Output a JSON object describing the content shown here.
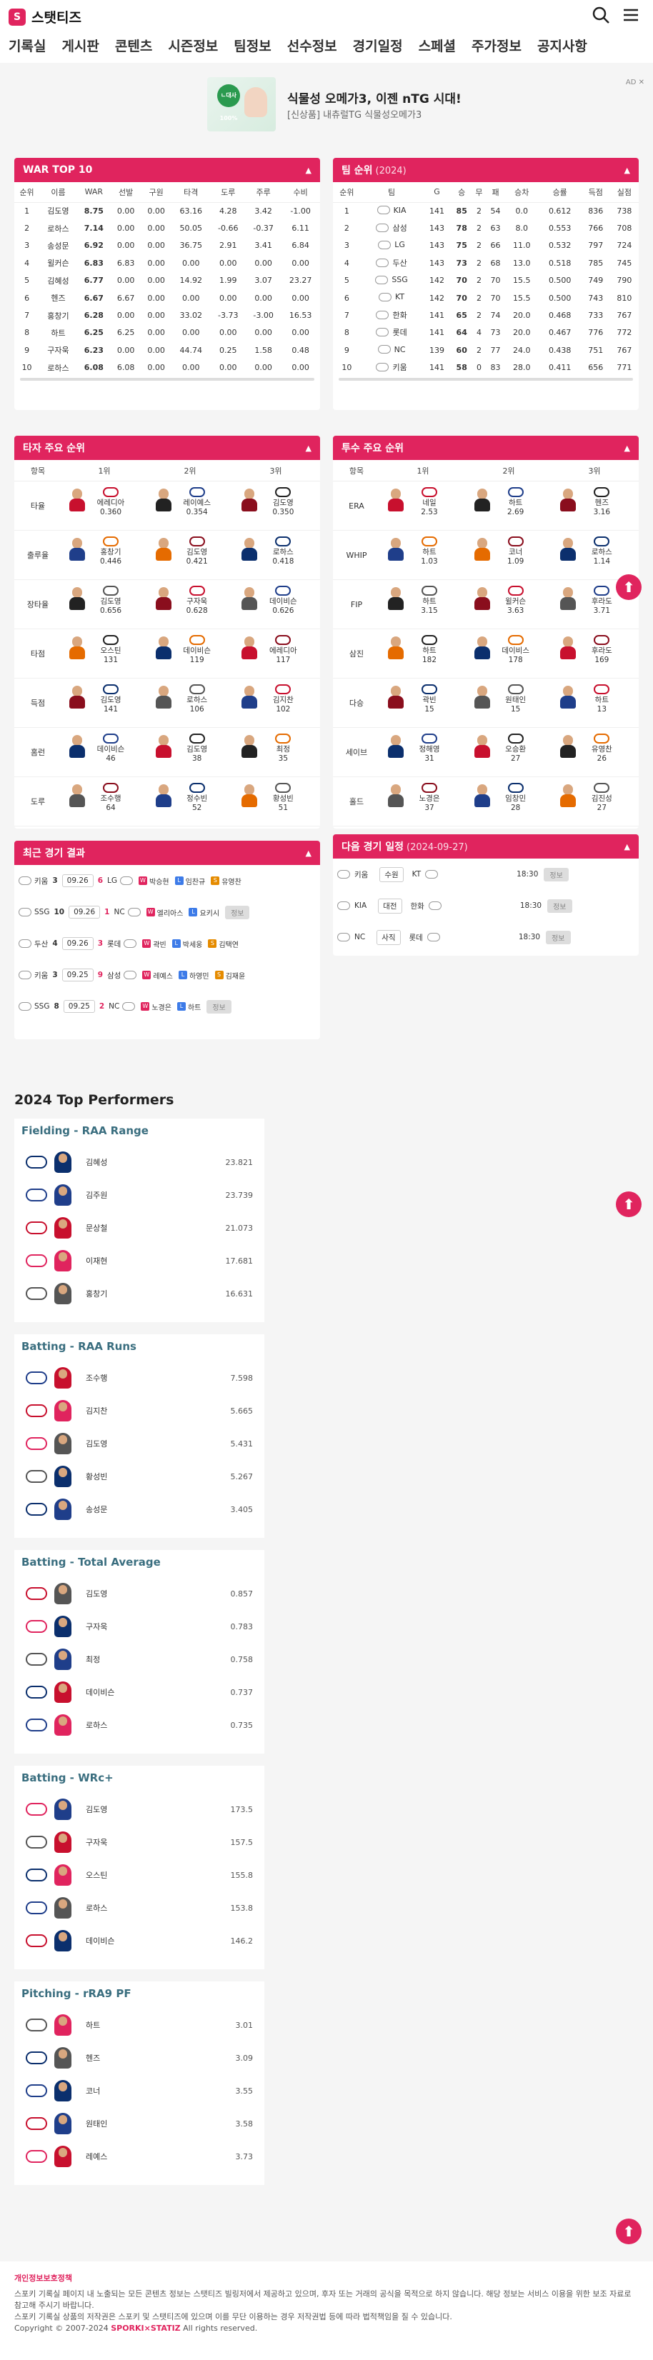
{
  "header": {
    "title": "스탯티즈",
    "logo_mark": "S"
  },
  "nav": [
    "기록실",
    "게시판",
    "콘텐츠",
    "시즌정보",
    "팀정보",
    "선수정보",
    "경기일정",
    "스페셜",
    "주가정보",
    "공지사항"
  ],
  "ad": {
    "headline": "식물성 오메가3, 이젠 nTG 시대!",
    "sub": "[신상품] 내츄럴TG 식물성오메가3",
    "badge": "ㄴ대사 100%",
    "mark": "AD ✕"
  },
  "war": {
    "title": "WAR TOP 10",
    "cols": [
      "순위",
      "이름",
      "WAR",
      "선발",
      "구원",
      "타격",
      "도루",
      "주루",
      "수비"
    ],
    "rows": [
      [
        "1",
        "김도영",
        "8.75",
        "0.00",
        "0.00",
        "63.16",
        "4.28",
        "3.42",
        "-1.00"
      ],
      [
        "2",
        "로하스",
        "7.14",
        "0.00",
        "0.00",
        "50.05",
        "-0.66",
        "-0.37",
        "6.11"
      ],
      [
        "3",
        "송성문",
        "6.92",
        "0.00",
        "0.00",
        "36.75",
        "2.91",
        "3.41",
        "6.84"
      ],
      [
        "4",
        "윌커슨",
        "6.83",
        "6.83",
        "0.00",
        "0.00",
        "0.00",
        "0.00",
        "0.00"
      ],
      [
        "5",
        "김혜성",
        "6.77",
        "0.00",
        "0.00",
        "14.92",
        "1.99",
        "3.07",
        "23.27"
      ],
      [
        "6",
        "헨즈",
        "6.67",
        "6.67",
        "0.00",
        "0.00",
        "0.00",
        "0.00",
        "0.00"
      ],
      [
        "7",
        "홍창기",
        "6.28",
        "0.00",
        "0.00",
        "33.02",
        "-3.73",
        "-3.00",
        "16.53"
      ],
      [
        "8",
        "하트",
        "6.25",
        "6.25",
        "0.00",
        "0.00",
        "0.00",
        "0.00",
        "0.00"
      ],
      [
        "9",
        "구자욱",
        "6.23",
        "0.00",
        "0.00",
        "44.74",
        "0.25",
        "1.58",
        "0.48"
      ],
      [
        "10",
        "로하스",
        "6.08",
        "6.08",
        "0.00",
        "0.00",
        "0.00",
        "0.00",
        "0.00"
      ]
    ]
  },
  "team_rank": {
    "title": "팀 순위",
    "year": "(2024)",
    "cols": [
      "순위",
      "팀",
      "G",
      "승",
      "무",
      "패",
      "승차",
      "승률",
      "득점",
      "실점"
    ],
    "rows": [
      [
        "1",
        "KIA",
        "141",
        "85",
        "2",
        "54",
        "0.0",
        "0.612",
        "836",
        "738"
      ],
      [
        "2",
        "삼성",
        "143",
        "78",
        "2",
        "63",
        "8.0",
        "0.553",
        "766",
        "708"
      ],
      [
        "3",
        "LG",
        "143",
        "75",
        "2",
        "66",
        "11.0",
        "0.532",
        "797",
        "724"
      ],
      [
        "4",
        "두산",
        "143",
        "73",
        "2",
        "68",
        "13.0",
        "0.518",
        "785",
        "745"
      ],
      [
        "5",
        "SSG",
        "142",
        "70",
        "2",
        "70",
        "15.5",
        "0.500",
        "749",
        "790"
      ],
      [
        "6",
        "KT",
        "142",
        "70",
        "2",
        "70",
        "15.5",
        "0.500",
        "743",
        "810"
      ],
      [
        "7",
        "한화",
        "141",
        "65",
        "2",
        "74",
        "20.0",
        "0.468",
        "733",
        "767"
      ],
      [
        "8",
        "롯데",
        "141",
        "64",
        "4",
        "73",
        "20.0",
        "0.467",
        "776",
        "772"
      ],
      [
        "9",
        "NC",
        "139",
        "60",
        "2",
        "77",
        "24.0",
        "0.438",
        "751",
        "767"
      ],
      [
        "10",
        "키움",
        "141",
        "58",
        "0",
        "83",
        "28.0",
        "0.411",
        "656",
        "771"
      ]
    ]
  },
  "bat_leaders": {
    "title": "타자 주요 순위",
    "cols": [
      "항목",
      "1위",
      "2위",
      "3위"
    ],
    "rows": [
      {
        "label": "타율",
        "p": [
          [
            "에레디아",
            "0.360"
          ],
          [
            "레이예스",
            "0.354"
          ],
          [
            "김도영",
            "0.350"
          ]
        ]
      },
      {
        "label": "출루율",
        "p": [
          [
            "홍창기",
            "0.446"
          ],
          [
            "김도영",
            "0.421"
          ],
          [
            "로하스",
            "0.418"
          ]
        ]
      },
      {
        "label": "장타율",
        "p": [
          [
            "김도영",
            "0.656"
          ],
          [
            "구자욱",
            "0.628"
          ],
          [
            "데이비슨",
            "0.626"
          ]
        ]
      },
      {
        "label": "타점",
        "p": [
          [
            "오스틴",
            "131"
          ],
          [
            "데이비슨",
            "119"
          ],
          [
            "에레디아",
            "117"
          ]
        ]
      },
      {
        "label": "득점",
        "p": [
          [
            "김도영",
            "141"
          ],
          [
            "로하스",
            "106"
          ],
          [
            "김지찬",
            "102"
          ]
        ]
      },
      {
        "label": "홈런",
        "p": [
          [
            "데이비슨",
            "46"
          ],
          [
            "김도영",
            "38"
          ],
          [
            "최정",
            "35"
          ]
        ]
      },
      {
        "label": "도루",
        "p": [
          [
            "조수행",
            "64"
          ],
          [
            "정수빈",
            "52"
          ],
          [
            "황성빈",
            "51"
          ]
        ]
      }
    ]
  },
  "pit_leaders": {
    "title": "투수 주요 순위",
    "cols": [
      "항목",
      "1위",
      "2위",
      "3위"
    ],
    "rows": [
      {
        "label": "ERA",
        "p": [
          [
            "네일",
            "2.53"
          ],
          [
            "하트",
            "2.69"
          ],
          [
            "헨즈",
            "3.16"
          ]
        ]
      },
      {
        "label": "WHIP",
        "p": [
          [
            "하트",
            "1.03"
          ],
          [
            "코너",
            "1.09"
          ],
          [
            "로하스",
            "1.14"
          ]
        ]
      },
      {
        "label": "FIP",
        "p": [
          [
            "하트",
            "3.15"
          ],
          [
            "윌커슨",
            "3.63"
          ],
          [
            "후라도",
            "3.71"
          ]
        ]
      },
      {
        "label": "삼진",
        "p": [
          [
            "하트",
            "182"
          ],
          [
            "데이비스",
            "178"
          ],
          [
            "후라도",
            "169"
          ]
        ]
      },
      {
        "label": "다승",
        "p": [
          [
            "곽빈",
            "15"
          ],
          [
            "원태인",
            "15"
          ],
          [
            "하트",
            "13"
          ]
        ]
      },
      {
        "label": "세이브",
        "p": [
          [
            "정해영",
            "31"
          ],
          [
            "오승환",
            "27"
          ],
          [
            "유영찬",
            "26"
          ]
        ]
      },
      {
        "label": "홀드",
        "p": [
          [
            "노경은",
            "37"
          ],
          [
            "임창민",
            "28"
          ],
          [
            "김진성",
            "27"
          ]
        ]
      }
    ]
  },
  "recent": {
    "title": "최근 경기 결과",
    "rows": [
      {
        "a": "키움",
        "as": "3",
        "date": "09.26",
        "bs": "6",
        "b": "LG",
        "w": "박승현",
        "l": "임찬규",
        "s": "유영찬",
        "btn": ""
      },
      {
        "a": "SSG",
        "as": "10",
        "date": "09.26",
        "bs": "1",
        "b": "NC",
        "w": "엘리아스",
        "l": "요키시",
        "s": "",
        "btn": "정보"
      },
      {
        "a": "두산",
        "as": "4",
        "date": "09.26",
        "bs": "3",
        "b": "롯데",
        "w": "곽빈",
        "l": "박세웅",
        "s": "김택연",
        "btn": ""
      },
      {
        "a": "키움",
        "as": "3",
        "date": "09.25",
        "bs": "9",
        "b": "삼성",
        "w": "레예스",
        "l": "하영민",
        "s": "김재윤",
        "btn": ""
      },
      {
        "a": "SSG",
        "as": "8",
        "date": "09.25",
        "bs": "2",
        "b": "NC",
        "w": "노경은",
        "l": "하트",
        "s": "",
        "btn": "정보"
      }
    ]
  },
  "schedule": {
    "title": "다음 경기 일정",
    "date": "(2024-09-27)",
    "rows": [
      {
        "a": "키움",
        "venue": "수원",
        "b": "KT",
        "time": "18:30",
        "btn": "정보"
      },
      {
        "a": "KIA",
        "venue": "대전",
        "b": "한화",
        "time": "18:30",
        "btn": "정보"
      },
      {
        "a": "NC",
        "venue": "사직",
        "b": "롯데",
        "time": "18:30",
        "btn": "정보"
      }
    ]
  },
  "performers_title": "2024 Top Performers",
  "performers": [
    {
      "title": "Fielding - RAA Range",
      "rows": [
        [
          "김혜성",
          "23.821"
        ],
        [
          "김주원",
          "23.739"
        ],
        [
          "문상철",
          "21.073"
        ],
        [
          "이재현",
          "17.681"
        ],
        [
          "홍창기",
          "16.631"
        ]
      ]
    },
    {
      "title": "Batting - RAA Runs",
      "rows": [
        [
          "조수행",
          "7.598"
        ],
        [
          "김지찬",
          "5.665"
        ],
        [
          "김도영",
          "5.431"
        ],
        [
          "황성빈",
          "5.267"
        ],
        [
          "송성문",
          "3.405"
        ]
      ]
    },
    {
      "title": "Batting - Total Average",
      "rows": [
        [
          "김도영",
          "0.857"
        ],
        [
          "구자욱",
          "0.783"
        ],
        [
          "최정",
          "0.758"
        ],
        [
          "데이비슨",
          "0.737"
        ],
        [
          "로하스",
          "0.735"
        ]
      ]
    },
    {
      "title": "Batting - WRc+",
      "rows": [
        [
          "김도영",
          "173.5"
        ],
        [
          "구자욱",
          "157.5"
        ],
        [
          "오스틴",
          "155.8"
        ],
        [
          "로하스",
          "153.8"
        ],
        [
          "데이비슨",
          "146.2"
        ]
      ]
    },
    {
      "title": "Pitching - rRA9 PF",
      "rows": [
        [
          "하트",
          "3.01"
        ],
        [
          "헨즈",
          "3.09"
        ],
        [
          "코너",
          "3.55"
        ],
        [
          "원태인",
          "3.58"
        ],
        [
          "레예스",
          "3.73"
        ]
      ]
    }
  ],
  "footer": {
    "privacy": "개인정보보호정책",
    "line1": "스포키 기록실 페이지 내 노출되는 모든 콘텐츠 정보는 스탯티즈 빌링저에서 제공하고 있으며, 후자 또는 거래의 공식을 목적으로 하지 않습니다. 해당 정보는 서비스 이용을 위한 보조 자료로 참고해 주시기 바랍니다.",
    "line2": "스포키 기록실 상품의 저작권은 스포키 및 스탯티즈에 있으며 이를 무단 이용하는 경우 저작권법 등에 따라 법적책임을 질 수 있습니다.",
    "copy_a": "Copyright © 2007-2024",
    "brand": "SPORKI×STATIZ",
    "copy_b": "All rights reserved."
  },
  "colors": {
    "accent": "#e0245e",
    "perf_title": "#3a6e7f"
  }
}
